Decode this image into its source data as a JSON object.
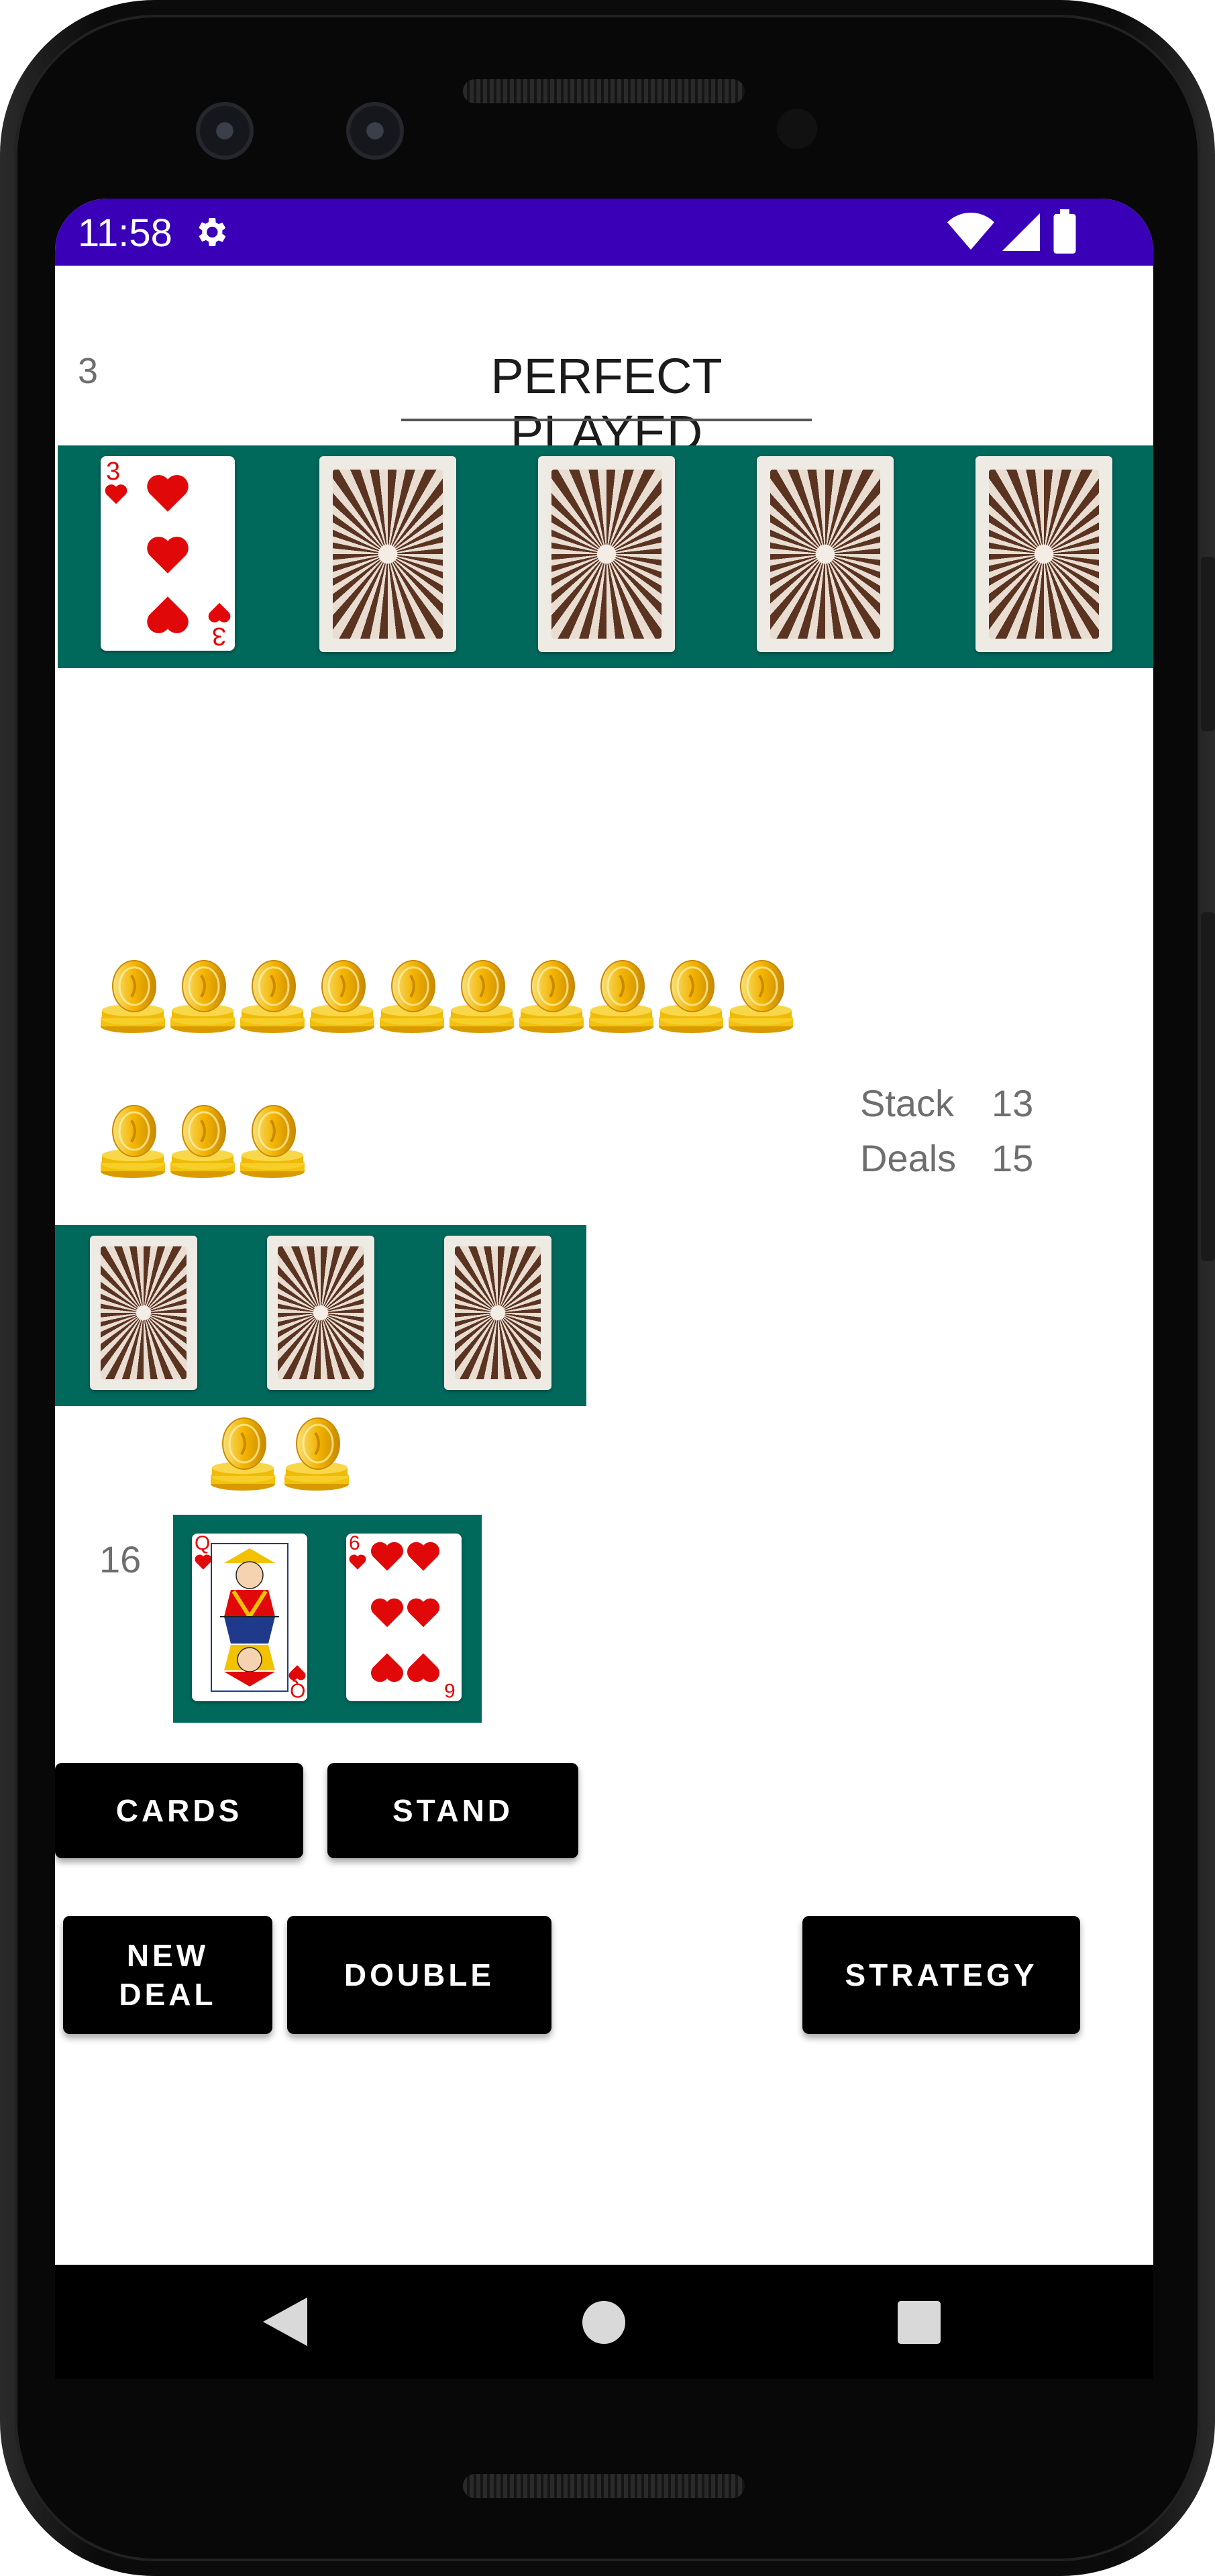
{
  "status_bar": {
    "time": "11:58",
    "icons": [
      "gear-icon",
      "wifi-icon",
      "signal-icon",
      "battery-icon"
    ]
  },
  "game": {
    "round_number": "3",
    "result_title": "PERFECT PLAYED",
    "stats": {
      "stack_label": "Stack",
      "stack_value": "13",
      "deals_label": "Deals",
      "deals_value": "15"
    },
    "player_total": "16",
    "dealer_hand": {
      "face_up": {
        "rank": "3",
        "suit": "hearts"
      },
      "face_down_count": 4
    },
    "split_hand_face_down_count": 3,
    "player_hand": [
      {
        "rank": "Q",
        "suit": "hearts"
      },
      {
        "rank": "6",
        "suit": "hearts"
      }
    ],
    "chip_rows": {
      "row1": 10,
      "row2": 3,
      "row3": 2
    }
  },
  "buttons": {
    "cards": "CARDS",
    "stand": "STAND",
    "new_deal": "NEW\nDEAL",
    "double": "DOUBLE",
    "strategy": "STRATEGY"
  },
  "colors": {
    "status_bar": "#3a00b8",
    "felt": "#00695c",
    "hearts": "#e1080a",
    "button": "#000000"
  }
}
